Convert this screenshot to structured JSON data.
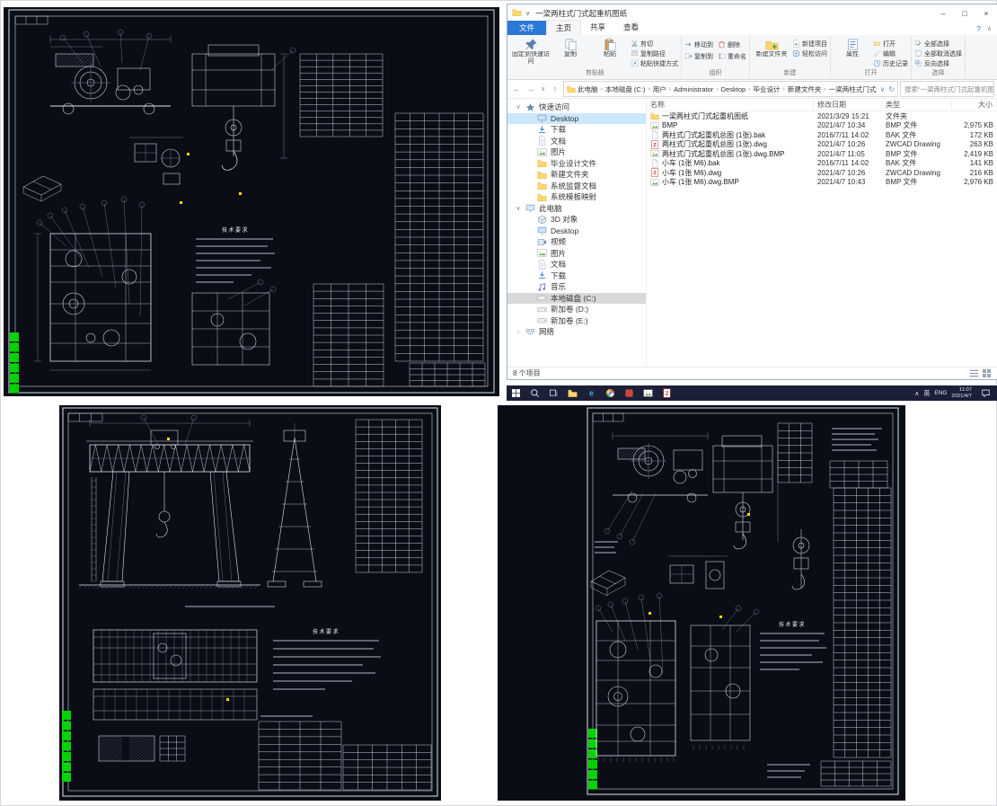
{
  "window": {
    "title": "一梁两柱式门式起重机图纸",
    "controls": {
      "minimize": "–",
      "maximize": "□",
      "close": "×"
    }
  },
  "ribbon": {
    "menu_tab": "文件",
    "tabs": [
      "主页",
      "共享",
      "查看"
    ],
    "active_tab": "主页",
    "help_icon": "?",
    "collapse_icon": "∧",
    "groups": [
      {
        "label": "剪贴板",
        "large": [
          {
            "label": "固定到快速访问",
            "icon": "pin"
          },
          {
            "label": "复制",
            "icon": "copy"
          },
          {
            "label": "粘贴",
            "icon": "paste"
          }
        ],
        "small": [
          {
            "label": "剪切",
            "icon": "cut"
          },
          {
            "label": "复制路径",
            "icon": "path"
          },
          {
            "label": "粘贴快捷方式",
            "icon": "shortcut"
          }
        ]
      },
      {
        "label": "组织",
        "large": [],
        "small": [
          {
            "label": "移动到",
            "icon": "move"
          },
          {
            "label": "复制到",
            "icon": "copyto"
          },
          {
            "label": "删除",
            "icon": "del"
          },
          {
            "label": "重命名",
            "icon": "rename"
          }
        ]
      },
      {
        "label": "新建",
        "large": [
          {
            "label": "新建文件夹",
            "icon": "newfolder"
          }
        ],
        "small": [
          {
            "label": "新建项目",
            "icon": "newitem"
          },
          {
            "label": "轻松访问",
            "icon": "easy"
          }
        ]
      },
      {
        "label": "打开",
        "large": [
          {
            "label": "属性",
            "icon": "props"
          }
        ],
        "small": [
          {
            "label": "打开",
            "icon": "open"
          },
          {
            "label": "编辑",
            "icon": "edit"
          },
          {
            "label": "历史记录",
            "icon": "history"
          }
        ]
      },
      {
        "label": "选择",
        "large": [],
        "small": [
          {
            "label": "全部选择",
            "icon": "selall"
          },
          {
            "label": "全部取消选择",
            "icon": "selnone"
          },
          {
            "label": "反向选择",
            "icon": "selinv"
          }
        ]
      }
    ]
  },
  "addressbar": {
    "breadcrumb": [
      "此电脑",
      "本地磁盘 (C:)",
      "用户",
      "Administrator",
      "Desktop",
      "毕业设计",
      "新建文件夹",
      "一梁两柱式门式起重机图纸"
    ],
    "search_placeholder": "搜索“一梁两柱式门式起重机图纸”"
  },
  "columns": [
    "名称",
    "修改日期",
    "类型",
    "大小"
  ],
  "files": [
    {
      "name": "一梁两柱式门式起重机图纸",
      "date": "2021/3/29 15:21",
      "type": "文件夹",
      "size": "",
      "icon": "folder"
    },
    {
      "name": "BMP",
      "date": "2021/4/7 10:34",
      "type": "BMP 文件",
      "size": "2,975 KB",
      "icon": "image"
    },
    {
      "name": "两柱式门式起重机总图 (1张).bak",
      "date": "2016/7/11 14:02",
      "type": "BAK 文件",
      "size": "172 KB",
      "icon": "bak"
    },
    {
      "name": "两柱式门式起重机总图 (1张).dwg",
      "date": "2021/4/7 10:26",
      "type": "ZWCAD Drawing",
      "size": "263 KB",
      "icon": "dwg"
    },
    {
      "name": "两柱式门式起重机总图 (1张).dwg.BMP",
      "date": "2021/4/7 11:05",
      "type": "BMP 文件",
      "size": "2,419 KB",
      "icon": "image"
    },
    {
      "name": "小车 (1张 M6).bak",
      "date": "2016/7/11 14:02",
      "type": "BAK 文件",
      "size": "141 KB",
      "icon": "bak"
    },
    {
      "name": "小车 (1张 M6).dwg",
      "date": "2021/4/7 10:26",
      "type": "ZWCAD Drawing",
      "size": "216 KB",
      "icon": "dwg"
    },
    {
      "name": "小车 (1张 M6).dwg.BMP",
      "date": "2021/4/7 10:43",
      "type": "BMP 文件",
      "size": "2,976 KB",
      "icon": "image"
    }
  ],
  "sidebar": {
    "sections": [
      {
        "label": "快速访问",
        "icon": "star",
        "expanded": true,
        "items": [
          {
            "label": "Desktop",
            "icon": "desktop",
            "selected": true
          },
          {
            "label": "下载",
            "icon": "download"
          },
          {
            "label": "文档",
            "icon": "doc"
          },
          {
            "label": "图片",
            "icon": "pictures"
          },
          {
            "label": "毕业设计文件",
            "icon": "folder"
          },
          {
            "label": "新建文件夹",
            "icon": "folder"
          },
          {
            "label": "系统监督文档",
            "icon": "folder"
          },
          {
            "label": "系统模板映射",
            "icon": "folder"
          }
        ]
      },
      {
        "label": "此电脑",
        "icon": "pc",
        "expanded": true,
        "items": [
          {
            "label": "3D 对象",
            "icon": "obj3d"
          },
          {
            "label": "Desktop",
            "icon": "desktop"
          },
          {
            "label": "视频",
            "icon": "videos"
          },
          {
            "label": "图片",
            "icon": "pictures"
          },
          {
            "label": "文档",
            "icon": "doc"
          },
          {
            "label": "下载",
            "icon": "download"
          },
          {
            "label": "音乐",
            "icon": "music"
          },
          {
            "label": "本地磁盘 (C:)",
            "icon": "disk",
            "selected": true,
            "selstyle": "gray"
          },
          {
            "label": "新加卷 (D:)",
            "icon": "disk"
          },
          {
            "label": "新加卷 (E:)",
            "icon": "disk"
          }
        ]
      },
      {
        "label": "网络",
        "icon": "net",
        "expanded": false,
        "items": []
      }
    ]
  },
  "statusbar": {
    "items_count": "8 个项目"
  },
  "taskbar": {
    "apps": [
      {
        "name": "file-explorer",
        "icon": "folder"
      },
      {
        "name": "edge-browser",
        "icon": "edge"
      },
      {
        "name": "chrome-browser",
        "icon": "chrome"
      },
      {
        "name": "app-red",
        "icon": "appred"
      },
      {
        "name": "image-viewer",
        "icon": "image"
      },
      {
        "name": "zwcad",
        "icon": "dwg"
      }
    ],
    "tray": {
      "chevron": "∧",
      "ime": "英",
      "lang": "ENG",
      "time": "11:07",
      "date": "2021/4/7"
    }
  },
  "cad": {
    "sheet_top": {
      "tech_req_title": "技术要求"
    },
    "sheet_gantry": {
      "tech_req_title": "技术要求"
    },
    "sheet_bottom": {
      "tech_req_title": "技术要求"
    }
  }
}
